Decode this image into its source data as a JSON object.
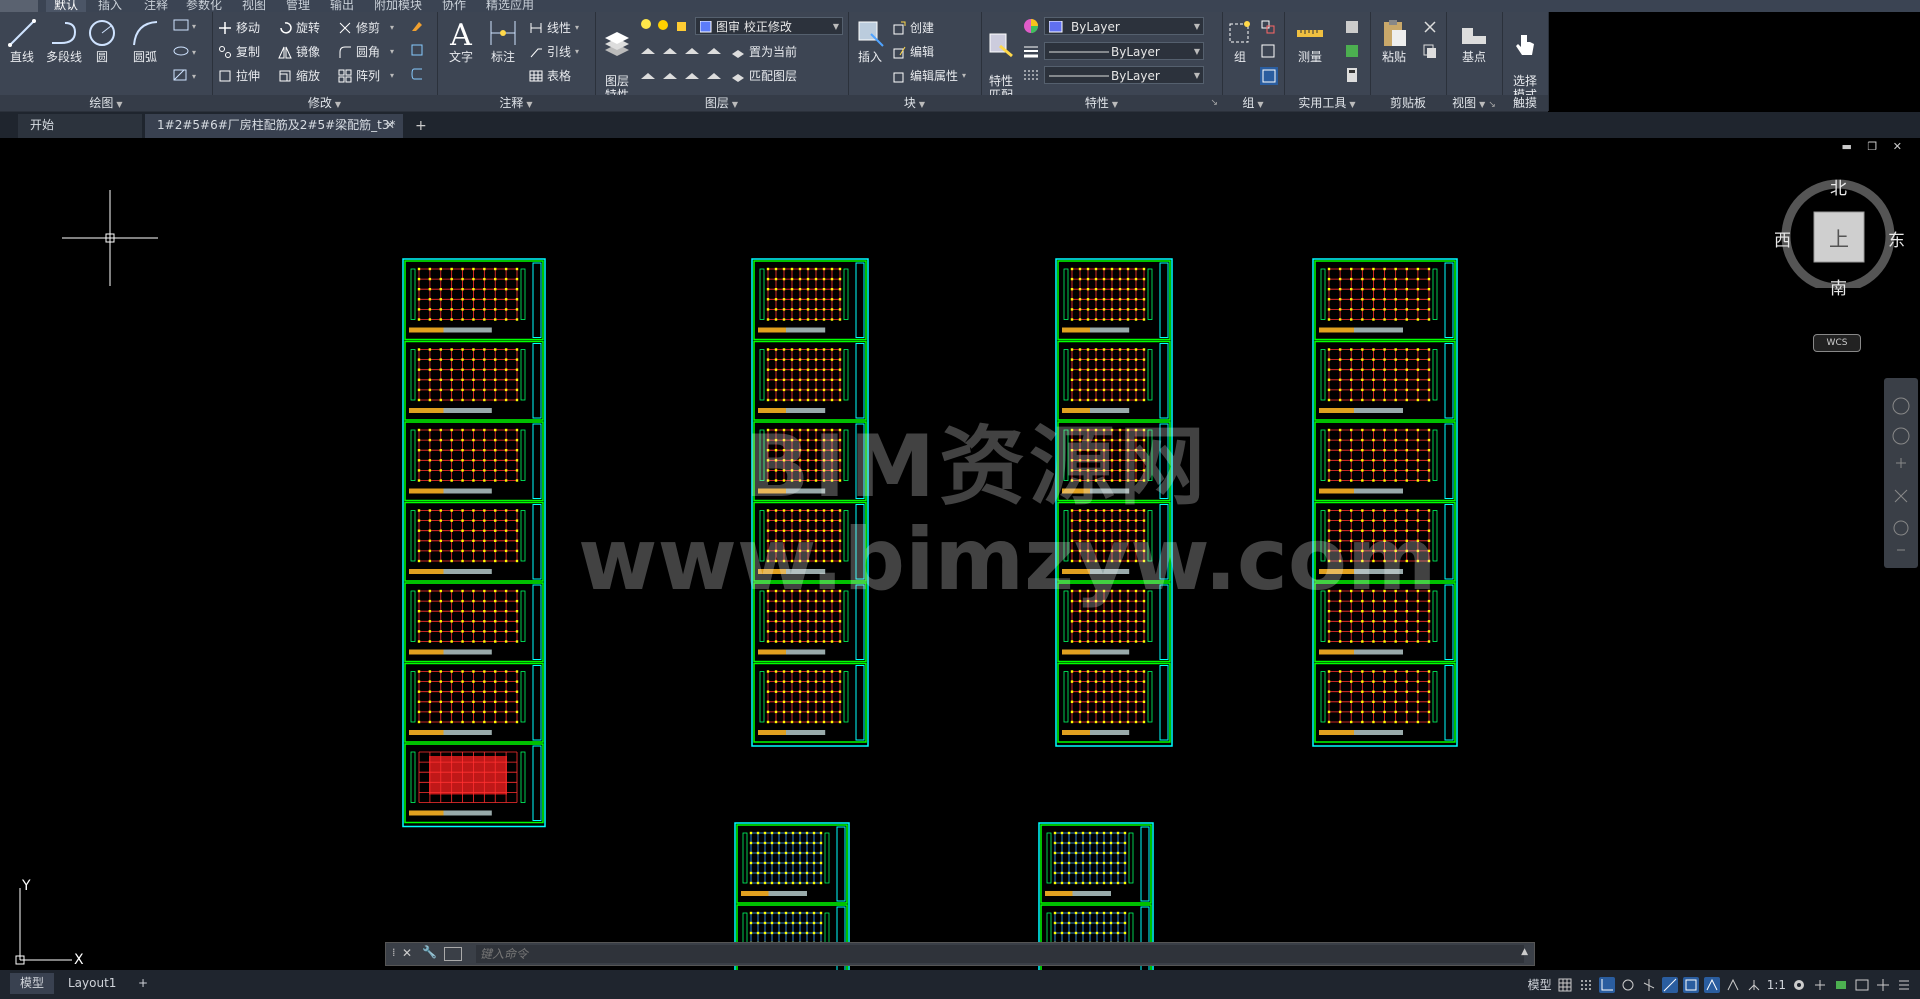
{
  "menu": {
    "tabs": [
      "默认",
      "插入",
      "注释",
      "参数化",
      "视图",
      "管理",
      "输出",
      "附加模块",
      "协作",
      "精选应用"
    ],
    "active": "默认"
  },
  "ribbon": {
    "draw": {
      "title": "绘图",
      "line": "直线",
      "polyline": "多段线",
      "circle": "圆",
      "arc": "圆弧"
    },
    "modify": {
      "title": "修改",
      "move": "移动",
      "rotate": "旋转",
      "trim": "修剪",
      "copy": "复制",
      "mirror": "镜像",
      "fillet": "圆角",
      "stretch": "拉伸",
      "scale": "缩放",
      "array": "阵列"
    },
    "annotation": {
      "title": "注释",
      "text": "文字",
      "dimension": "标注",
      "linear": "线性",
      "leader": "引线",
      "table": "表格"
    },
    "layers": {
      "title": "图层",
      "layer_props": "图层\n特性",
      "layer_combo": "图审 校正修改",
      "set_current": "置为当前",
      "match_layer": "匹配图层"
    },
    "block": {
      "title": "块",
      "insert": "插入",
      "create": "创建",
      "edit": "编辑",
      "edit_attr": "编辑属性"
    },
    "properties": {
      "title": "特性",
      "match": "特性\n匹配",
      "color": "ByLayer",
      "linetype": "ByLayer",
      "lineweight": "ByLayer"
    },
    "groups": {
      "title": "组",
      "group": "组"
    },
    "utilities": {
      "title": "实用工具",
      "measure": "测量"
    },
    "clipboard": {
      "title": "剪贴板",
      "paste": "粘贴"
    },
    "view": {
      "title": "视图",
      "base": "基点"
    },
    "touch": {
      "title": "触摸",
      "select_mode": "选择\n模式"
    }
  },
  "file_tabs": {
    "start": "开始",
    "doc": "1#2#5#6#厂房柱配筋及2#5#梁配筋_t3*",
    "close": "✕",
    "add": "+"
  },
  "viewcube": {
    "north": "北",
    "south": "南",
    "east": "东",
    "west": "西",
    "top": "上",
    "wcs": "WCS"
  },
  "watermark": {
    "line1": "BIM资源网",
    "line2": "www.bimzyw.com"
  },
  "ucs": {
    "x": "X",
    "y": "Y"
  },
  "command": {
    "placeholder": "键入命令"
  },
  "status": {
    "model_tab": "模型",
    "layout_tab": "Layout1",
    "add": "+",
    "model_space": "模型",
    "scale": "1:1"
  },
  "colors": {
    "sheet_border": "#00ff00",
    "frame_border": "#00ffff",
    "grid_red": "#ff3030",
    "grid_yellow": "#ffff00",
    "ribbon_bg": "#3d4553"
  }
}
